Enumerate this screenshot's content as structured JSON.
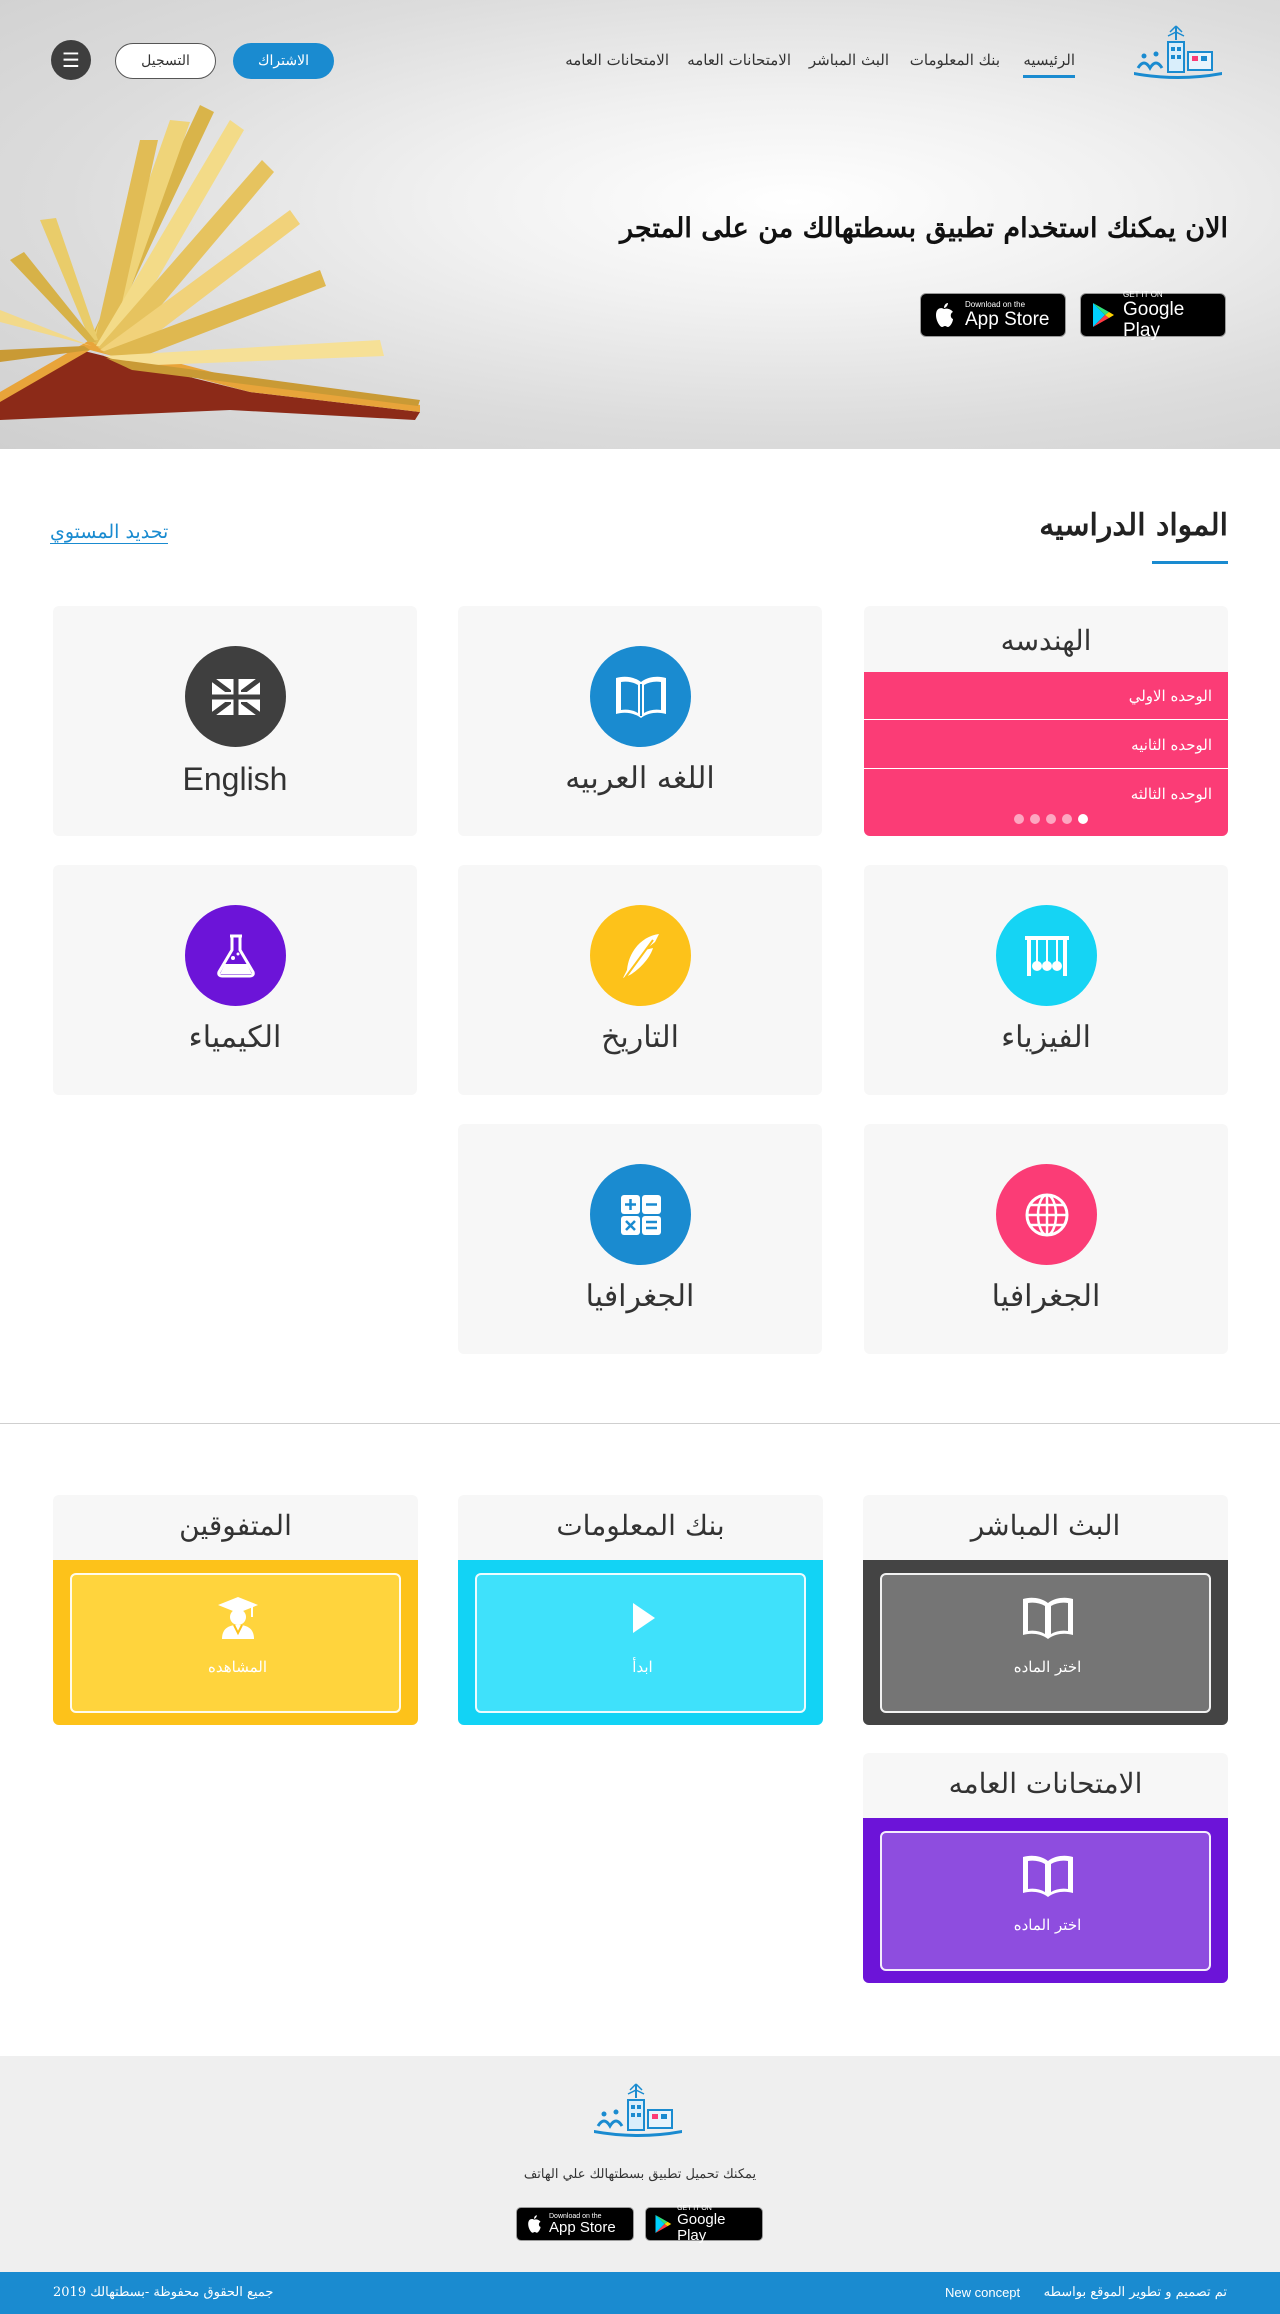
{
  "nav": {
    "links": [
      "الرئيسيه",
      "بنك المعلومات",
      "البث المباشر",
      "الامتحانات العامه",
      "الامتحانات العامه"
    ],
    "subscribe": "الاشتراك",
    "register": "التسجيل",
    "menu_icon": "☰"
  },
  "hero": {
    "title": "الان يمكنك استخدام تطبيق بسطتهالك من على المتجر",
    "google_play": {
      "small": "GET IT ON",
      "big": "Google Play"
    },
    "app_store": {
      "small": "Download on the",
      "big": "App Store"
    }
  },
  "subjects": {
    "title": "المواد الدراسيه",
    "level_link": "تحديد المستوي",
    "featured": {
      "title": "الهندسه",
      "units": [
        "الوحده الاولي",
        "الوحده الثانيه",
        "الوحده الثالثه"
      ],
      "dots": 5,
      "active_dot": 0
    },
    "cards": [
      {
        "label": "اللغه العربيه",
        "icon": "book-icon",
        "color": "#1a8bd0"
      },
      {
        "label": "English",
        "icon": "uk-flag-icon",
        "color": "#3f3f3f"
      },
      {
        "label": "الفيزياء",
        "icon": "newtons-cradle-icon",
        "color": "#15d4f4"
      },
      {
        "label": "التاريخ",
        "icon": "feather-icon",
        "color": "#fdc21a"
      },
      {
        "label": "الكيمياء",
        "icon": "flask-icon",
        "color": "#6c14d8"
      },
      {
        "label": "الجغرافيا",
        "icon": "globe-icon",
        "color": "#fb3c76"
      },
      {
        "label": "الجغرافيا",
        "icon": "calculator-icon",
        "color": "#1a8bd0"
      }
    ]
  },
  "features": [
    {
      "title": "البث المباشر",
      "action": "اختر الماده",
      "icon": "book-icon",
      "color": "#444444",
      "inner": "#757575"
    },
    {
      "title": "بنك المعلومات",
      "action": "ابدأ",
      "icon": "play-icon",
      "color": "#12d3f5",
      "inner": "#3fe1fb"
    },
    {
      "title": "المتفوقين",
      "action": "المشاهده",
      "icon": "graduate-icon",
      "color": "#fdc21a",
      "inner": "#ffd43d"
    },
    {
      "title": "الامتحانات العامه",
      "action": "اختر الماده",
      "icon": "book-icon",
      "color": "#6c14d8",
      "inner": "#8e4ddf"
    }
  ],
  "footer": {
    "download_text": "يمكنك  تحميل تطبيق بسطتهالك علي الهاتف",
    "copyright": "جميع الحقوق محفوظة -بسطتهالك 2019",
    "credit": "تم تصميم و تطوير الموقع بواسطه",
    "company": "New concept"
  }
}
